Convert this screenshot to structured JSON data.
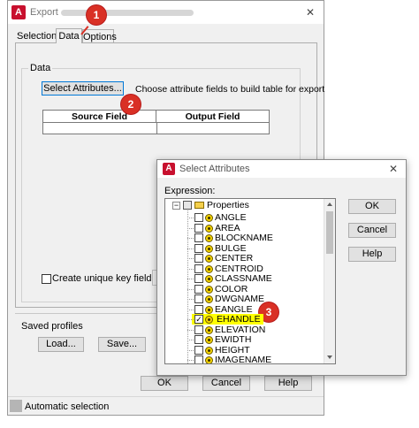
{
  "export_dialog": {
    "title": "Export",
    "tabs": [
      "Selection",
      "Data",
      "Options"
    ],
    "data_group_label": "Data",
    "select_attributes_button": "Select Attributes...",
    "select_attributes_hint": "Choose attribute fields to build table for export",
    "table_headers": [
      "Source Field",
      "Output Field"
    ],
    "unique_key_label": "Create unique key field:",
    "saved_profiles_label": "Saved profiles",
    "load_button": "Load...",
    "save_button": "Save...",
    "ok_button": "OK",
    "cancel_button": "Cancel",
    "help_button": "Help",
    "status_text": "Automatic selection",
    "close_glyph": "✕"
  },
  "select_attributes_dialog": {
    "title": "Select Attributes",
    "expression_label": "Expression:",
    "root_label": "Properties",
    "expand_glyph": "−",
    "items": [
      {
        "label": "ANGLE",
        "checked": false
      },
      {
        "label": "AREA",
        "checked": false
      },
      {
        "label": "BLOCKNAME",
        "checked": false
      },
      {
        "label": "BULGE",
        "checked": false
      },
      {
        "label": "CENTER",
        "checked": false
      },
      {
        "label": "CENTROID",
        "checked": false
      },
      {
        "label": "CLASSNAME",
        "checked": false
      },
      {
        "label": "COLOR",
        "checked": false
      },
      {
        "label": "DWGNAME",
        "checked": false
      },
      {
        "label": "EANGLE",
        "checked": false
      },
      {
        "label": "EHANDLE",
        "checked": true
      },
      {
        "label": "ELEVATION",
        "checked": false
      },
      {
        "label": "EWIDTH",
        "checked": false
      },
      {
        "label": "HEIGHT",
        "checked": false
      },
      {
        "label": "IMAGENAME",
        "checked": false
      }
    ],
    "ok_button": "OK",
    "cancel_button": "Cancel",
    "help_button": "Help",
    "close_glyph": "✕"
  },
  "markers": [
    "1",
    "2",
    "3"
  ],
  "colors": {
    "marker": "#d93025",
    "highlight": "#ffff00",
    "focus_border": "#0078d7",
    "app_icon": "#c8102e"
  }
}
